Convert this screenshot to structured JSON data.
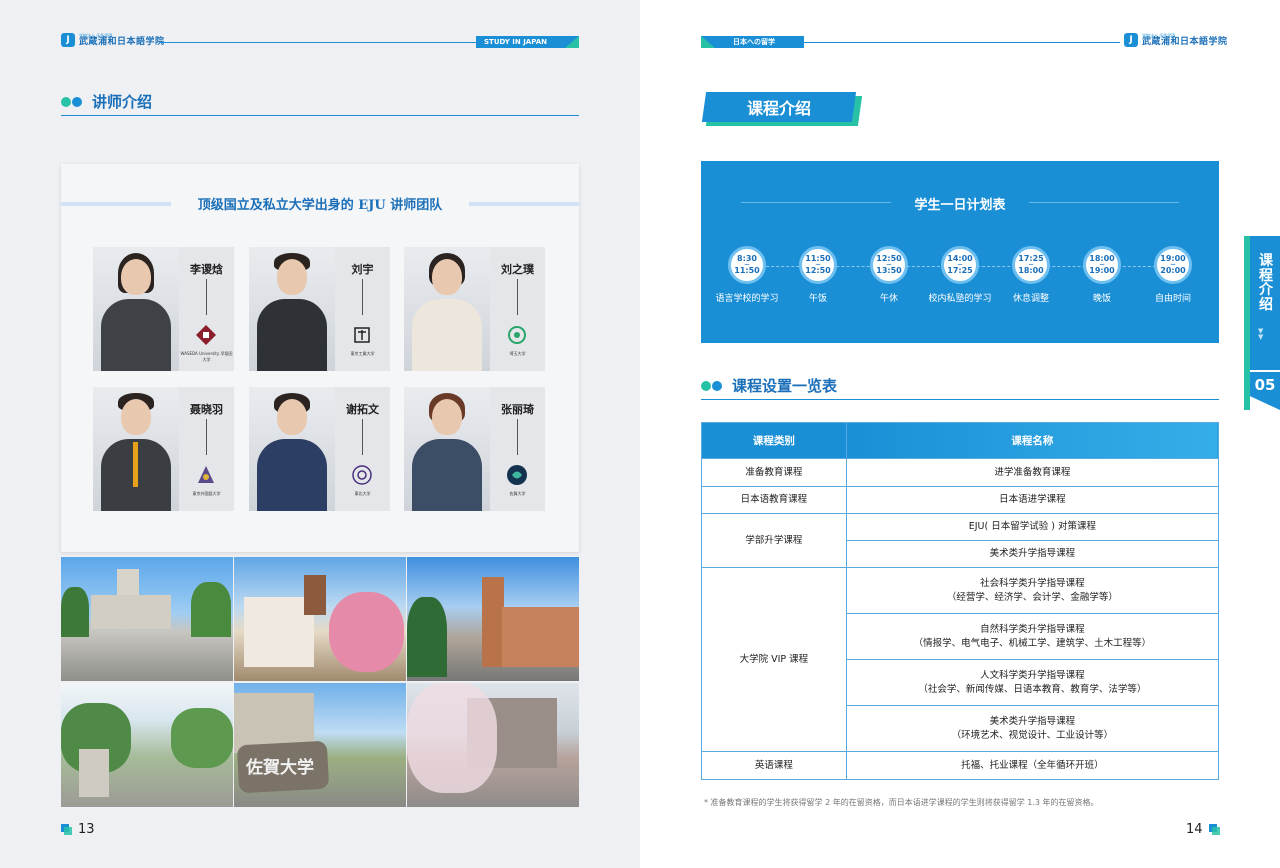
{
  "left_page": {
    "logo": {
      "small": "学校法人 千条学園",
      "main": "武蔵浦和日本語学院"
    },
    "header_tag": "STUDY IN JAPAN",
    "section_title": "讲师介绍",
    "card_title": "顶级国立及私立大学出身的 EJU 讲师团队",
    "teachers": [
      {
        "name": "李谡焓",
        "university": "WASEDA University 早稲田大学"
      },
      {
        "name": "刘宇",
        "university": "東京工業大学"
      },
      {
        "name": "刘之璞",
        "university": "埼玉大学"
      },
      {
        "name": "聂晓羽",
        "university": "東京外国語大学"
      },
      {
        "name": "谢拓文",
        "university": "東北大学"
      },
      {
        "name": "张丽琦",
        "university": "佐賀大学"
      }
    ],
    "photo_sign_text": "佐賀大学",
    "page_number": "13"
  },
  "right_page": {
    "header_tag": "日本への留学",
    "logo": {
      "small": "学校法人 千条学園",
      "main": "武蔵浦和日本語学院"
    },
    "ribbon_title": "课程介绍",
    "schedule": {
      "title": "学生一日计划表",
      "items": [
        {
          "start": "8:30",
          "end": "11:50",
          "label": "语言学校的学习"
        },
        {
          "start": "11:50",
          "end": "12:50",
          "label": "午饭"
        },
        {
          "start": "12:50",
          "end": "13:50",
          "label": "午休"
        },
        {
          "start": "14:00",
          "end": "17:25",
          "label": "校内私塾的学习"
        },
        {
          "start": "17:25",
          "end": "18:00",
          "label": "休息调整"
        },
        {
          "start": "18:00",
          "end": "19:00",
          "label": "晚饭"
        },
        {
          "start": "19:00",
          "end": "20:00",
          "label": "自由时间"
        }
      ]
    },
    "table_section_title": "课程设置一览表",
    "table": {
      "headers": [
        "课程类别",
        "课程名称"
      ],
      "rows": {
        "prep": {
          "category": "准备教育课程",
          "course": "进学准备教育课程"
        },
        "jp": {
          "category": "日本语教育课程",
          "course": "日本语进学课程"
        },
        "undergrad": {
          "category": "学部升学课程",
          "courses": [
            "EJU( 日本留学试验 ) 对策课程",
            "美术类升学指导课程"
          ]
        },
        "grad": {
          "category": "大学院 VIP 课程",
          "courses": [
            {
              "line1": "社会科学类升学指导课程",
              "line2": "（经营学、经济学、会计学、金融学等）"
            },
            {
              "line1": "自然科学类升学指导课程",
              "line2": "（情报学、电气电子、机械工学、建筑学、土木工程等）"
            },
            {
              "line1": "人文科学类升学指导课程",
              "line2": "（社会学、新闻传媒、日语本教育、教育学、法学等）"
            },
            {
              "line1": "美术类升学指导课程",
              "line2": "（环境艺术、视觉设计、工业设计等）"
            }
          ]
        },
        "english": {
          "category": "英语课程",
          "course": "托福、托业课程（全年循环开班）"
        }
      }
    },
    "footnote": "* 准备教育课程的学生将获得留学 2 年的在留资格，而日本语进学课程的学生则将获得留学 1.3 年的在留资格。",
    "side_tab": {
      "text": "课程介绍",
      "number": "05"
    },
    "page_number": "14"
  },
  "colors": {
    "primary": "#1a8fd6",
    "accent": "#27c2a6",
    "heading": "#1a6fb8"
  }
}
